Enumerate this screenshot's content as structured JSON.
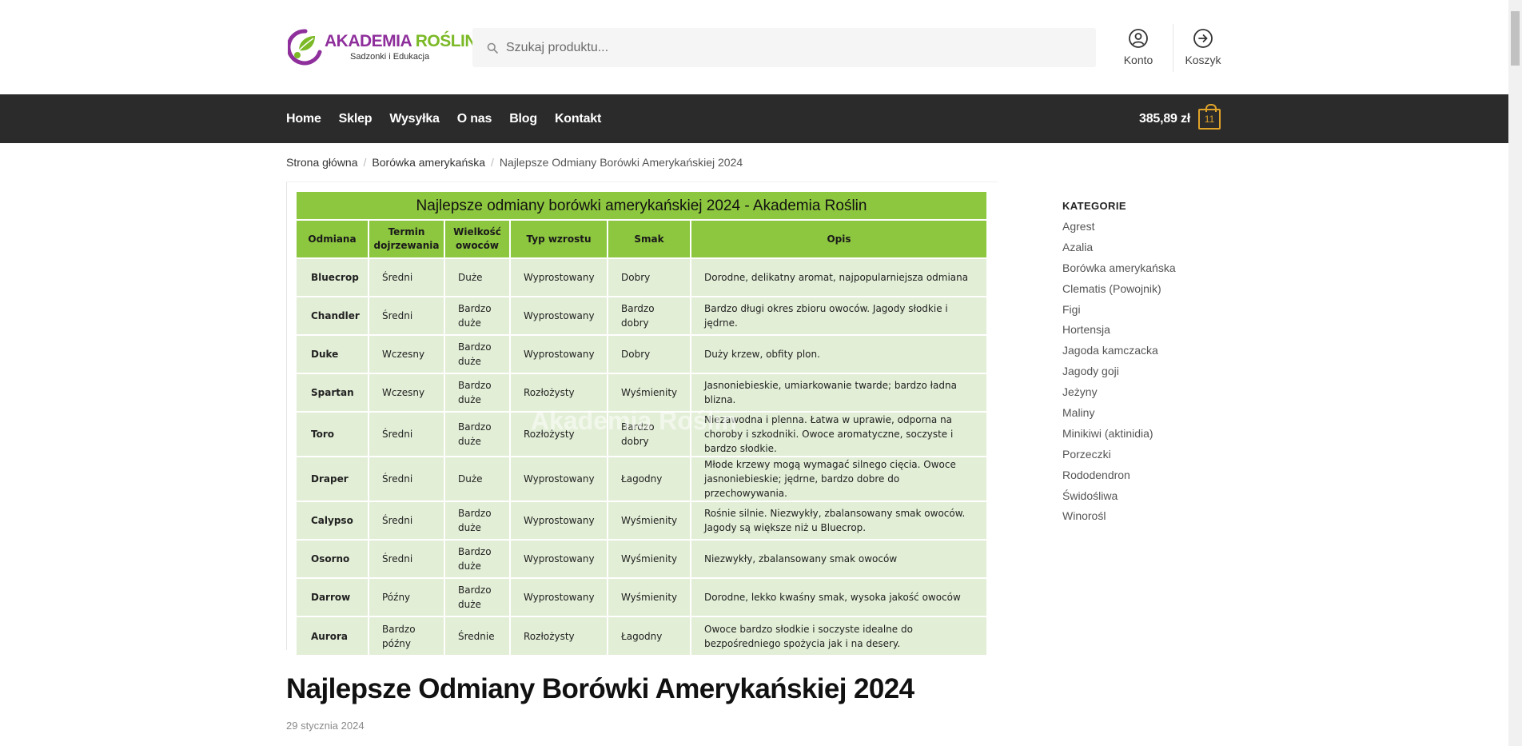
{
  "header": {
    "logo_main_1": "AKADEMIA ",
    "logo_main_2": "ROŚLIN",
    "logo_sub": "Sadzonki i Edukacja",
    "search_placeholder": "Szukaj produktu...",
    "account_label": "Konto",
    "cart_label": "Koszyk"
  },
  "nav": {
    "items": [
      "Home",
      "Sklep",
      "Wysyłka",
      "O nas",
      "Blog",
      "Kontakt"
    ],
    "cart_total": "385,89 zł",
    "cart_count": "11"
  },
  "breadcrumb": {
    "items": [
      "Strona główna",
      "Borówka amerykańska"
    ],
    "current": "Najlepsze Odmiany Borówki Amerykańskiej 2024"
  },
  "table": {
    "title": "Najlepsze odmiany borówki amerykańskiej 2024 - Akademia Roślin",
    "watermark": "Akademia Roślin",
    "headers": [
      "Odmiana",
      "Termin dojrzewania",
      "Wielkość owoców",
      "Typ wzrostu",
      "Smak",
      "Opis"
    ],
    "rows": [
      [
        "Bluecrop",
        "Średni",
        "Duże",
        "Wyprostowany",
        "Dobry",
        "Dorodne, delikatny aromat, najpopularniejsza odmiana"
      ],
      [
        "Chandler",
        "Średni",
        "Bardzo duże",
        "Wyprostowany",
        "Bardzo dobry",
        "Bardzo długi okres zbioru owoców. Jagody słodkie i jędrne."
      ],
      [
        "Duke",
        "Wczesny",
        "Bardzo duże",
        "Wyprostowany",
        "Dobry",
        "Duży krzew, obfity plon."
      ],
      [
        "Spartan",
        "Wczesny",
        "Bardzo duże",
        "Rozłożysty",
        "Wyśmienity",
        "Jasnoniebieskie, umiarkowanie twarde; bardzo ładna blizna."
      ],
      [
        "Toro",
        "Średni",
        "Bardzo duże",
        "Rozłożysty",
        "Bardzo dobry",
        "Niezawodna i plenna. Łatwa w uprawie, odporna na choroby i szkodniki. Owoce aromatyczne, soczyste i bardzo słodkie."
      ],
      [
        "Draper",
        "Średni",
        "Duże",
        "Wyprostowany",
        "Łagodny",
        "Młode krzewy mogą wymagać silnego cięcia. Owoce jasnoniebieskie; jędrne, bardzo dobre do przechowywania."
      ],
      [
        "Calypso",
        "Średni",
        "Bardzo duże",
        "Wyprostowany",
        "Wyśmienity",
        "Rośnie silnie. Niezwykły, zbalansowany smak owoców. Jagody są większe niż u Bluecrop."
      ],
      [
        "Osorno",
        "Średni",
        "Bardzo duże",
        "Wyprostowany",
        "Wyśmienity",
        "Niezwykły, zbalansowany smak owoców"
      ],
      [
        "Darrow",
        "Późny",
        "Bardzo duże",
        "Wyprostowany",
        "Wyśmienity",
        "Dorodne, lekko kwaśny smak, wysoka jakość owoców"
      ],
      [
        "Aurora",
        "Bardzo późny",
        "Średnie",
        "Rozłożysty",
        "Łagodny",
        "Owoce bardzo słodkie i soczyste idealne do bezpośredniego spożycia jak i na desery."
      ]
    ]
  },
  "post": {
    "title": "Najlepsze Odmiany Borówki Amerykańskiej 2024",
    "date": "29 stycznia 2024"
  },
  "sidebar": {
    "heading": "KATEGORIE",
    "categories": [
      "Agrest",
      "Azalia",
      "Borówka amerykańska",
      "Clematis (Powojnik)",
      "Figi",
      "Hortensja",
      "Jagoda kamczacka",
      "Jagody goji",
      "Jeżyny",
      "Maliny",
      "Minikiwi (aktinidia)",
      "Porzeczki",
      "Rododendron",
      "Świdośliwa",
      "Winorośl"
    ]
  },
  "colors": {
    "nav_bg": "#2b2b2b",
    "table_header_green": "#8dc63f",
    "table_cell_green": "#e2eed6",
    "cart_accent": "#e0a32a",
    "logo_purple": "#8e2f9c",
    "logo_green": "#7bb927"
  },
  "icons": {
    "search": "search-icon",
    "account": "user-circle-icon",
    "cart": "arrow-circle-right-icon",
    "cart_bag": "shopping-bag-icon",
    "logo": "leaf-logo-icon"
  }
}
